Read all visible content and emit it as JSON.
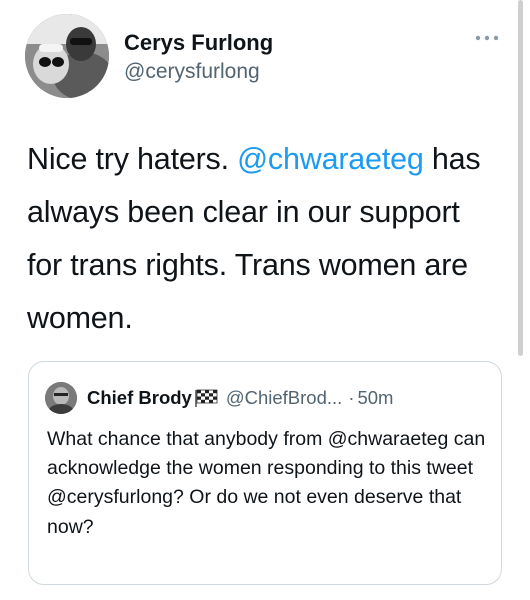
{
  "tweet": {
    "author": {
      "display_name": "Cerys Furlong",
      "handle": "@cerysfurlong",
      "avatar_icon": "profile-photo"
    },
    "more_icon": "more-horizontal-icon",
    "text_parts": [
      "Nice try haters. ",
      "@chwaraeteg",
      " has always been clear in our support for trans rights. Trans women are women."
    ],
    "mention_color": "#1d9bf0"
  },
  "quoted_tweet": {
    "author": {
      "display_name": "Chief Brody",
      "emoji_icon": "chequered-flag-icon",
      "handle": "@ChiefBrod...",
      "avatar_icon": "profile-photo"
    },
    "separator": "·",
    "time_ago": "50m",
    "text": "What chance that anybody from @chwaraeteg can acknowledge the women responding to this tweet @cerysfurlong? Or do we not even deserve that now?"
  },
  "colors": {
    "text_primary": "#0f1419",
    "text_secondary": "#536471",
    "link": "#1d9bf0",
    "border": "#cfd9de"
  }
}
